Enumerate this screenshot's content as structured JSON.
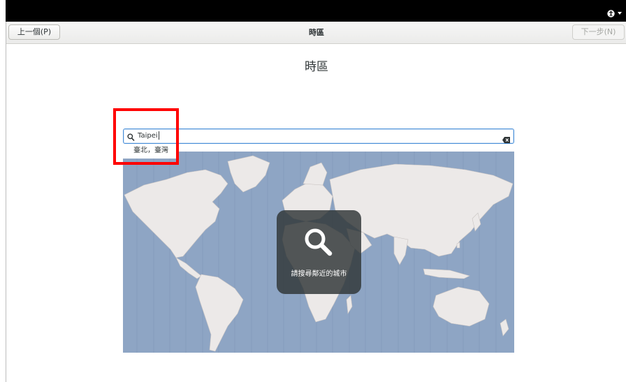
{
  "header": {
    "prev_button": "上一個(P)",
    "title": "時區",
    "next_button": "下一步(N)"
  },
  "page_title": "時區",
  "search": {
    "value": "Taipei",
    "completion": "臺北，臺灣"
  },
  "map": {
    "overlay_text": "請搜尋鄰近的城市"
  },
  "colors": {
    "ocean": "#8ea5c4",
    "land": "#ece9e8",
    "highlight": "#ff0000",
    "focus": "#4a90d9"
  },
  "icons": [
    "accessibility-icon",
    "chevron-down-icon",
    "search-icon",
    "clear-icon"
  ]
}
